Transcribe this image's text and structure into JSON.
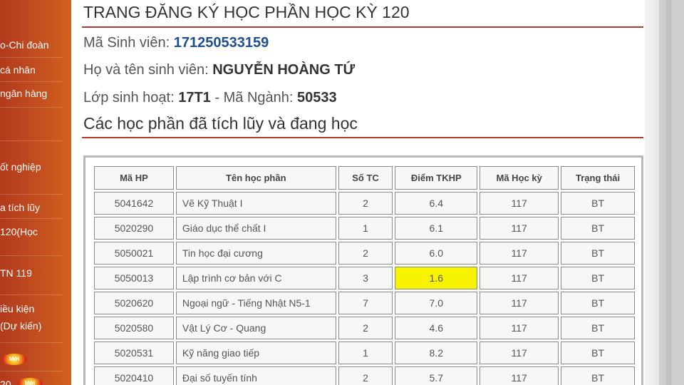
{
  "sidebar": {
    "items": [
      {
        "label": "o-Chi đoàn"
      },
      {
        "label": "cá nhân"
      },
      {
        "label": "ngân hàng"
      },
      {
        "label": "ốt nghiệp"
      },
      {
        "label": "a tích lũy"
      },
      {
        "label": "120(Học"
      },
      {
        "label": "TN 119"
      },
      {
        "label": "iều kiện"
      },
      {
        "label": "(Dự kiến)"
      },
      {
        "label": "20"
      }
    ],
    "badge_text": "Mới"
  },
  "header": {
    "title": "TRANG ĐĂNG KÝ HỌC PHẦN HỌC KỲ 120",
    "student_id_label": "Mã Sinh viên:",
    "student_id": "171250533159",
    "name_label": "Họ và tên sinh viên:",
    "name": "NGUYỄN HOÀNG TỨ",
    "class_label": "Lớp sinh hoạt:",
    "class": "17T1",
    "sep": "-",
    "major_label": "Mã Ngành:",
    "major": "50533"
  },
  "section_title": "Các học phần đã tích lũy và đang học",
  "table": {
    "columns": [
      "Mã HP",
      "Tên học phần",
      "Số TC",
      "Điểm TKHP",
      "Mã Học kỳ",
      "Trạng thái"
    ],
    "rows": [
      {
        "code": "5041642",
        "name": "Vẽ Kỹ Thuật I",
        "credits": "2",
        "score": "6.4",
        "term": "117",
        "status": "BT"
      },
      {
        "code": "5020290",
        "name": "Giáo dục thể chất I",
        "credits": "1",
        "score": "6.1",
        "term": "117",
        "status": "BT"
      },
      {
        "code": "5050021",
        "name": "Tin học đại cương",
        "credits": "2",
        "score": "6.0",
        "term": "117",
        "status": "BT"
      },
      {
        "code": "5050013",
        "name": "Lập trình cơ bản với C",
        "credits": "3",
        "score": "1.6",
        "term": "117",
        "status": "BT"
      },
      {
        "code": "5020620",
        "name": "Ngoại ngữ - Tiếng Nhật N5-1",
        "credits": "7",
        "score": "7.0",
        "term": "117",
        "status": "BT"
      },
      {
        "code": "5020580",
        "name": "Vật Lý Cơ - Quang",
        "credits": "2",
        "score": "4.6",
        "term": "117",
        "status": "BT"
      },
      {
        "code": "5020531",
        "name": "Kỹ năng giao tiếp",
        "credits": "1",
        "score": "8.2",
        "term": "117",
        "status": "BT"
      },
      {
        "code": "5020410",
        "name": "Đại số tuyến tính",
        "credits": "2",
        "score": "5.7",
        "term": "117",
        "status": "BT"
      }
    ],
    "highlight_color": "#f7f200"
  },
  "colors": {
    "accent_rule": "#b23a2a",
    "student_id": "#1f4f8f",
    "sidebar": "#c4501f"
  }
}
